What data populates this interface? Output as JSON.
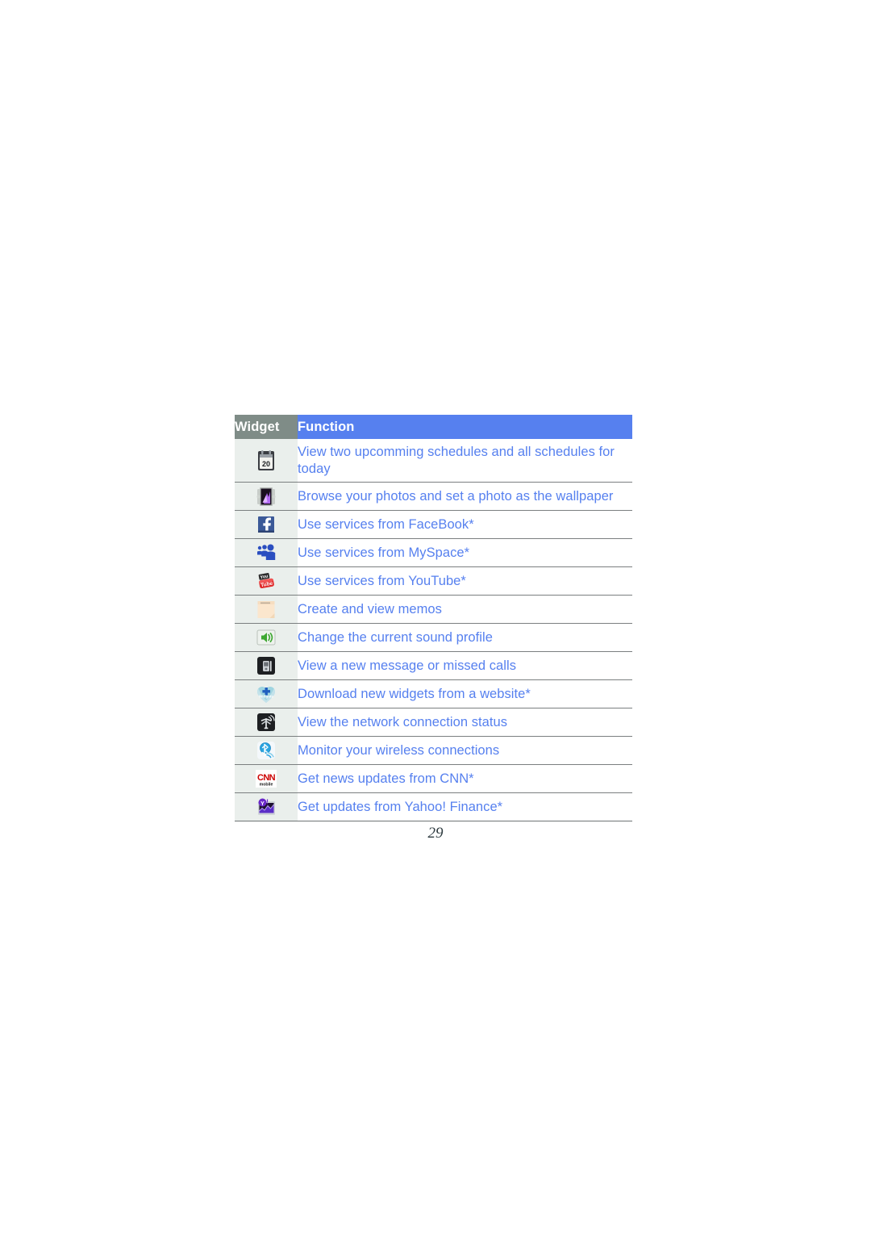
{
  "document": {
    "page_number": "29"
  },
  "table": {
    "headers": {
      "widget": "Widget",
      "function": "Function"
    },
    "colors": {
      "header_widget_bg": "#7f8c87",
      "header_function_bg": "#5680ef",
      "body_text": "#5680ef",
      "icon_cell_bg": "#eaefec",
      "row_rule": "#7b7f80"
    },
    "rows": [
      {
        "icon": "calendar-icon",
        "function": "View two upcomming schedules and all schedules for today"
      },
      {
        "icon": "photo-gallery-icon",
        "function": "Browse your photos and set a photo as the wallpaper"
      },
      {
        "icon": "facebook-icon",
        "function": "Use services from FaceBook*"
      },
      {
        "icon": "myspace-icon",
        "function": "Use services from MySpace*"
      },
      {
        "icon": "youtube-icon",
        "function": "Use services from YouTube*"
      },
      {
        "icon": "memo-note-icon",
        "function": "Create and view memos"
      },
      {
        "icon": "sound-profile-speaker-icon",
        "function": "Change the current sound profile"
      },
      {
        "icon": "missed-events-phone-icon",
        "function": "View a new message or missed calls"
      },
      {
        "icon": "widgets-download-icon",
        "function": "Download new widgets from a website*"
      },
      {
        "icon": "network-antenna-icon",
        "function": "View the network connection status"
      },
      {
        "icon": "bluetooth-icon",
        "function": "Monitor your wireless connections"
      },
      {
        "icon": "cnn-mobile-icon",
        "function": "Get news updates from CNN*"
      },
      {
        "icon": "yahoo-finance-icon",
        "function": "Get updates from Yahoo! Finance*"
      }
    ]
  }
}
